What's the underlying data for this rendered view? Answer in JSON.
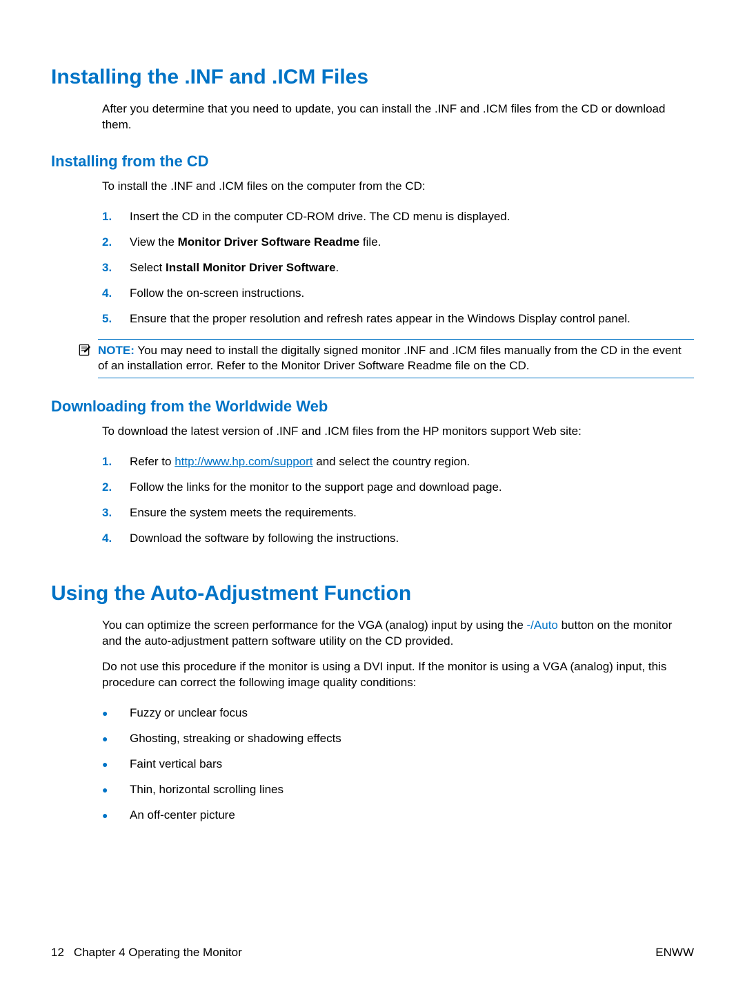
{
  "section1": {
    "title": "Installing the .INF and .ICM Files",
    "intro": "After you determine that you need to update, you can install the .INF and .ICM files from the CD or download them.",
    "sub1": {
      "title": "Installing from the CD",
      "intro": "To install the .INF and .ICM files on the computer from the CD:",
      "steps": {
        "s1_num": "1.",
        "s1_text": "Insert the CD in the computer CD-ROM drive. The CD menu is displayed.",
        "s2_num": "2.",
        "s2_pre": "View the ",
        "s2_bold": "Monitor Driver Software Readme",
        "s2_post": " file.",
        "s3_num": "3.",
        "s3_pre": "Select ",
        "s3_bold": "Install Monitor Driver Software",
        "s3_post": ".",
        "s4_num": "4.",
        "s4_text": "Follow the on-screen instructions.",
        "s5_num": "5.",
        "s5_text": "Ensure that the proper resolution and refresh rates appear in the Windows Display control panel."
      },
      "note_label": "NOTE:",
      "note_text": " You may need to install the digitally signed monitor .INF and .ICM files manually from the CD in the event of an installation error. Refer to the Monitor Driver Software Readme file on the CD."
    },
    "sub2": {
      "title": "Downloading from the Worldwide Web",
      "intro": "To download the latest version of .INF and .ICM files from the HP monitors support Web site:",
      "steps": {
        "s1_num": "1.",
        "s1_pre": "Refer to ",
        "s1_link": "http://www.hp.com/support",
        "s1_post": " and select the country region.",
        "s2_num": "2.",
        "s2_text": "Follow the links for the monitor to the support page and download page.",
        "s3_num": "3.",
        "s3_text": "Ensure the system meets the requirements.",
        "s4_num": "4.",
        "s4_text": "Download the software by following the instructions."
      }
    }
  },
  "section2": {
    "title": "Using the Auto-Adjustment Function",
    "p1_pre": "You can optimize the screen performance for the VGA (analog) input by using the ",
    "p1_blue": "-/Auto",
    "p1_post": " button on the monitor and the auto-adjustment pattern software utility on the CD provided.",
    "p2": "Do not use this procedure if the monitor is using a DVI input. If the monitor is using a VGA (analog) input, this procedure can correct the following image quality conditions:",
    "bullets": {
      "b1": "Fuzzy or unclear focus",
      "b2": "Ghosting, streaking or shadowing effects",
      "b3": "Faint vertical bars",
      "b4": "Thin, horizontal scrolling lines",
      "b5": "An off-center picture"
    },
    "bullet_dot": "●"
  },
  "footer": {
    "page": "12",
    "chapter": "Chapter 4   Operating the Monitor",
    "right": "ENWW"
  }
}
